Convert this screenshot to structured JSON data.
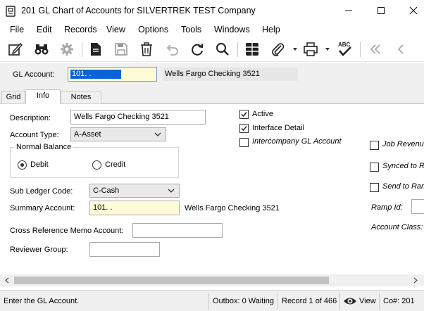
{
  "window": {
    "title": "201 GL Chart of Accounts for SILVERTREK TEST Company",
    "minimize_icon": "minimize-icon",
    "maximize_icon": "maximize-icon",
    "close_icon": "close-icon"
  },
  "menu": [
    "File",
    "Edit",
    "Records",
    "View",
    "Options",
    "Tools",
    "Windows",
    "Help"
  ],
  "toolbar": {
    "icons": [
      "edit-icon",
      "binoculars-icon",
      "settings-icon",
      "document-icon",
      "save-icon",
      "delete-icon",
      "undo-icon",
      "refresh-icon",
      "search-icon",
      "grid-icon",
      "attach-icon",
      "print-icon",
      "spellcheck-icon",
      "first-record-icon",
      "previous-record-icon"
    ],
    "spellcheck_label": "ABC"
  },
  "header": {
    "gl_account_label": "GL Account:",
    "gl_account_value": "101.  .",
    "gl_account_desc": "Wells Fargo Checking 3521"
  },
  "tabs": [
    {
      "label": "Grid",
      "active": false
    },
    {
      "label": "Info",
      "active": true
    },
    {
      "label": "Notes",
      "active": false
    }
  ],
  "info": {
    "description_label": "Description:",
    "description_value": "Wells Fargo Checking 3521",
    "account_type_label": "Account Type:",
    "account_type_value": "A-Asset",
    "normal_balance_label": "Normal Balance",
    "debit_label": "Debit",
    "credit_label": "Credit",
    "normal_balance_selected": "Debit",
    "sub_ledger_label": "Sub Ledger Code:",
    "sub_ledger_value": "C-Cash",
    "summary_account_label": "Summary Account:",
    "summary_account_value": "101.  .",
    "summary_account_desc": "Wells Fargo Checking 3521",
    "cross_ref_label": "Cross Reference Memo Account:",
    "cross_ref_value": "",
    "reviewer_label": "Reviewer Group:",
    "reviewer_value": "",
    "active_label": "Active",
    "active_checked": true,
    "interface_label": "Interface Detail",
    "interface_checked": true,
    "intercompany_label": "Intercompany GL Account",
    "intercompany_checked": false,
    "job_revenue_label": "Job Revenu",
    "synced_label": "Synced to R",
    "send_ramp_label": "Send to Ram",
    "ramp_id_label": "Ramp Id:",
    "account_class_label": "Account Class:"
  },
  "status": {
    "message": "Enter the GL Account.",
    "outbox": "Outbox: 0 Waiting",
    "record": "Record 1 of 466",
    "view": "View",
    "company": "Co#: 201"
  },
  "colors": {
    "selection": "#0a64d8",
    "required_field": "#fefbd8",
    "chrome": "#f0f0f0"
  }
}
